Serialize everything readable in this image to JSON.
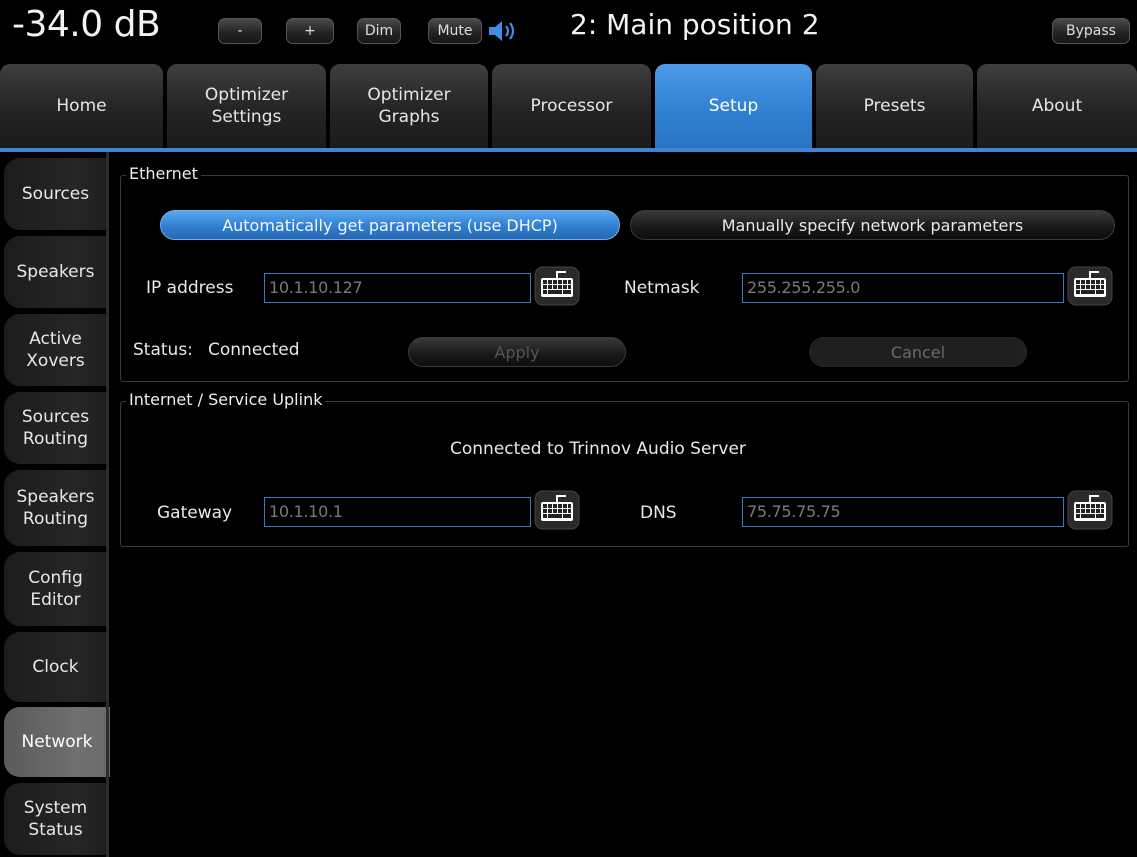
{
  "topbar": {
    "volume": "-34.0 dB",
    "minus_label": "-",
    "plus_label": "+",
    "dim_label": "Dim",
    "mute_label": "Mute",
    "speaker_icon": "speaker-volume-icon",
    "preset_title": "2: Main position 2",
    "bypass_label": "Bypass"
  },
  "tabs": [
    {
      "label": "Home"
    },
    {
      "label": "Optimizer Settings"
    },
    {
      "label": "Optimizer Graphs"
    },
    {
      "label": "Processor"
    },
    {
      "label": "Setup",
      "active": true
    },
    {
      "label": "Presets"
    },
    {
      "label": "About"
    }
  ],
  "sidebar": {
    "items": [
      {
        "label": "Sources"
      },
      {
        "label": "Speakers"
      },
      {
        "label": "Active Xovers"
      },
      {
        "label": "Sources Routing"
      },
      {
        "label": "Speakers Routing"
      },
      {
        "label": "Config Editor"
      },
      {
        "label": "Clock"
      },
      {
        "label": "Network",
        "active": true
      },
      {
        "label": "System Status"
      }
    ]
  },
  "ethernet": {
    "legend": "Ethernet",
    "dhcp_label": "Automatically get parameters (use DHCP)",
    "manual_label": "Manually specify network parameters",
    "ip_label": "IP address",
    "ip_value": "10.1.10.127",
    "netmask_label": "Netmask",
    "netmask_value": "255.255.255.0",
    "status_label": "Status:",
    "status_value": "Connected",
    "apply_label": "Apply",
    "cancel_label": "Cancel",
    "keyboard_icon": "keyboard-icon"
  },
  "internet": {
    "legend": "Internet / Service Uplink",
    "message": "Connected to Trinnov Audio Server",
    "gateway_label": "Gateway",
    "gateway_value": "10.1.10.1",
    "dns_label": "DNS",
    "dns_value": "75.75.75.75"
  },
  "colors": {
    "accent": "#3d86d3",
    "field_border": "#3b78c0",
    "background": "#000000"
  }
}
